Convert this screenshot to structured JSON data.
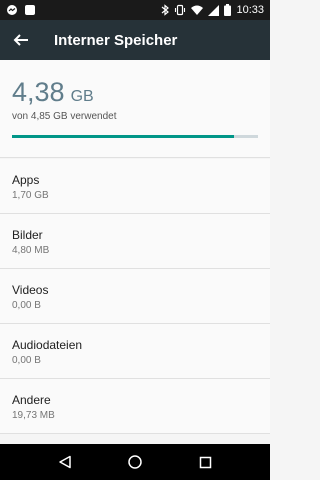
{
  "status_bar": {
    "time": "10:33",
    "icons": [
      "messenger-icon",
      "notification-icon",
      "bluetooth-icon",
      "vibrate-icon",
      "wifi-icon",
      "signal-icon",
      "battery-icon"
    ]
  },
  "app_bar": {
    "title": "Interner Speicher",
    "back_icon": "arrow-back-icon"
  },
  "summary": {
    "used_value": "4,38",
    "used_unit": "GB",
    "subtitle": "von 4,85 GB verwendet",
    "progress_fraction": 0.903,
    "colors": {
      "accent": "#009688",
      "used_text": "#607d8b",
      "appbar": "#263238"
    }
  },
  "list": {
    "items": [
      {
        "label": "Apps",
        "value": "1,70 GB"
      },
      {
        "label": "Bilder",
        "value": "4,80 MB"
      },
      {
        "label": "Videos",
        "value": "0,00 B"
      },
      {
        "label": "Audiodateien",
        "value": "0,00 B"
      },
      {
        "label": "Andere",
        "value": "19,73 MB"
      }
    ]
  },
  "nav_bar": {
    "buttons": [
      "back-triangle-icon",
      "home-circle-icon",
      "recents-square-icon"
    ]
  }
}
